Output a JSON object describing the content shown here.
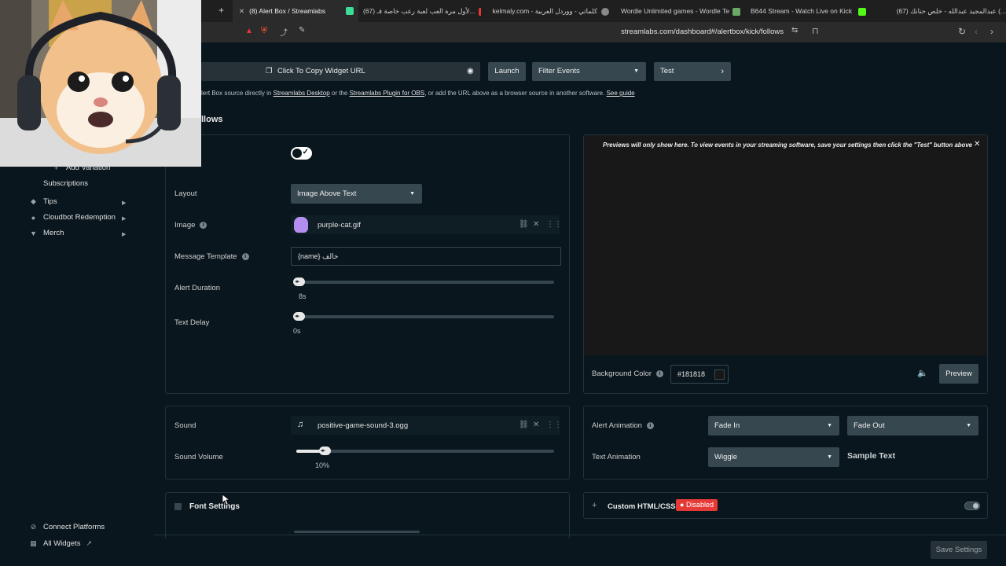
{
  "browser": {
    "tabs": [
      {
        "label": "(8) Alert Box / Streamlabs",
        "active": true
      },
      {
        "label": "(67) لأول مرة العب لعبة رعب خاصة فـ...",
        "active": false
      },
      {
        "label": "kelmaly.com - كلماتي - ووردل العربية",
        "active": false
      },
      {
        "label": "Wordle Unlimited games - Wordle Te",
        "active": false
      },
      {
        "label": "B644 Stream - Watch Live on Kick",
        "active": false
      },
      {
        "label": "(67) عبدالمجيد عبدالله - خلص حنانك (...",
        "active": false
      }
    ],
    "new_tab": "+",
    "url": "streamlabs.com/dashboard#/alertbox/kick/follows"
  },
  "sidebar": {
    "add_variation": "Add Variation",
    "subscriptions": "Subscriptions",
    "items": [
      {
        "label": "Tips",
        "icon": "tag-icon"
      },
      {
        "label": "Cloudbot Redemption",
        "icon": "cloudbot-icon"
      },
      {
        "label": "Merch",
        "icon": "shirt-icon"
      }
    ],
    "connect_platforms": "Connect Platforms",
    "all_widgets": "All Widgets"
  },
  "toolbar": {
    "copy_url": "Click To Copy Widget URL",
    "launch": "Launch",
    "filter_events": "Filter Events",
    "test": "Test"
  },
  "hint": {
    "prefix": "lert Box source directly in",
    "link1": "Streamlabs Desktop",
    "mid": "or the",
    "link2": "Streamlabs Plugin for OBS",
    "suffix": ", or add the URL above as a browser source in another software.",
    "link3": "See guide"
  },
  "section_title": "llows",
  "settings": {
    "layout_label": "Layout",
    "layout_value": "Image Above Text",
    "image_label": "Image",
    "image_file": "purple-cat.gif",
    "message_template_label": "Message Template",
    "message_template_value": "{name} خالف",
    "alert_duration_label": "Alert Duration",
    "alert_duration_value": "8s",
    "alert_duration_fraction": 0.0,
    "text_delay_label": "Text Delay",
    "text_delay_value": "0s",
    "text_delay_fraction": 0.0
  },
  "preview": {
    "notice": "Previews will only show here. To view events in your streaming software, save your settings then click the \"Test\" button above.",
    "background_color_label": "Background Color",
    "background_color_value": "#181818",
    "preview_button": "Preview"
  },
  "sound": {
    "label": "Sound",
    "file": "positive-game-sound-3.ogg",
    "volume_label": "Sound Volume",
    "volume_value": "10%",
    "volume_fraction": 0.1
  },
  "animation": {
    "alert_animation_label": "Alert Animation",
    "in": "Fade In",
    "out": "Fade Out",
    "text_animation_label": "Text Animation",
    "text_anim": "Wiggle",
    "sample_text": "Sample Text"
  },
  "font_settings": "Font Settings",
  "custom_html": {
    "label": "Custom HTML/CSS",
    "badge": "Disabled"
  },
  "save_settings": "Save Settings",
  "colors": {
    "background": "#09161d",
    "button": "#37474f",
    "disabled_badge": "#e53935",
    "preview_bg": "#181818"
  }
}
